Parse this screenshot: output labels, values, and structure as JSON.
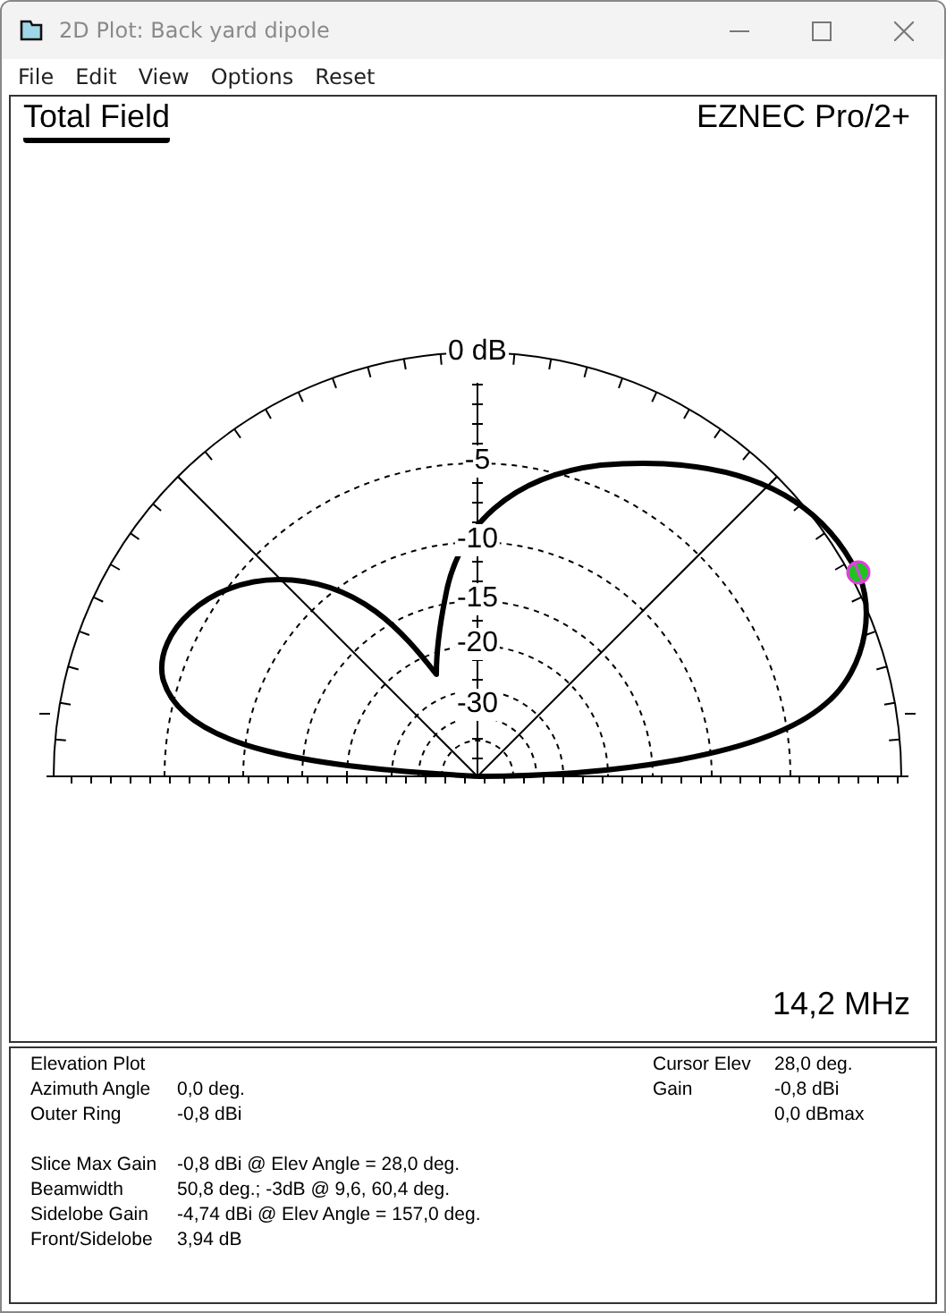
{
  "window": {
    "title": "2D Plot: Back yard dipole"
  },
  "menu": [
    "File",
    "Edit",
    "View",
    "Options",
    "Reset"
  ],
  "plot": {
    "title": "Total Field",
    "program": "EZNEC Pro/2+",
    "ring_labels": [
      "0 dB",
      "-5",
      "-10",
      "-15",
      "-20",
      "-30"
    ],
    "frequency": "14,2 MHz"
  },
  "info": {
    "left": [
      {
        "label": "Elevation Plot"
      },
      {
        "label": "Azimuth Angle",
        "value": "0,0 deg."
      },
      {
        "label": "Outer Ring",
        "value": "-0,8 dBi"
      }
    ],
    "results": [
      {
        "label": "Slice Max Gain",
        "value": "-0,8 dBi @ Elev Angle = 28,0 deg."
      },
      {
        "label": "Beamwidth",
        "value": "50,8 deg.; -3dB @ 9,6, 60,4 deg."
      },
      {
        "label": "Sidelobe Gain",
        "value": "-4,74 dBi @ Elev Angle = 157,0 deg."
      },
      {
        "label": "Front/Sidelobe",
        "value": "3,94 dB"
      }
    ],
    "right": [
      {
        "label": "Cursor Elev",
        "value": "28,0 deg."
      },
      {
        "label": "Gain",
        "value": "-0,8 dBi"
      },
      {
        "value": "0,0 dBmax"
      }
    ]
  }
}
